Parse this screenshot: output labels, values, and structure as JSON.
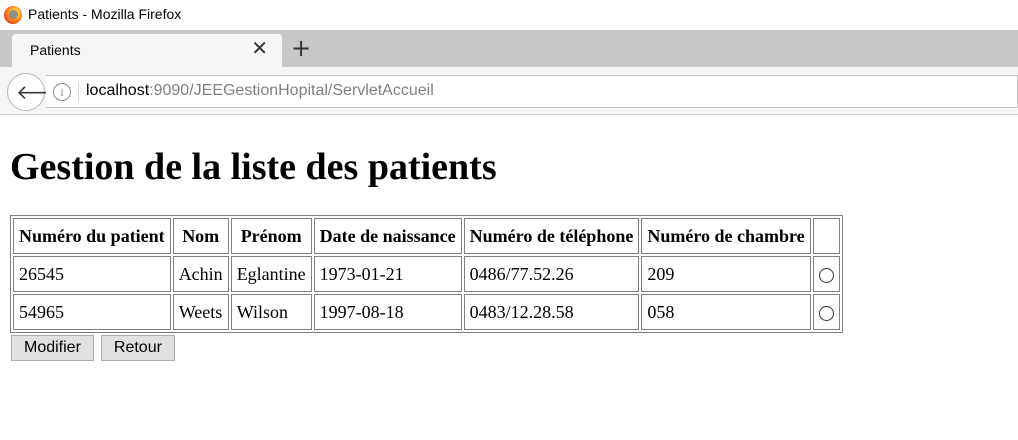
{
  "window": {
    "title": "Patients - Mozilla Firefox",
    "logo_icon": "firefox-logo-icon"
  },
  "tabs": [
    {
      "label": "Patients",
      "active": true
    }
  ],
  "toolbar": {
    "close_tab_glyph": "✕",
    "new_tab_glyph": "+",
    "back_glyph": "🡐",
    "info_glyph": "i",
    "url_host": "localhost",
    "url_rest": ":9090/JEEGestionHopital/ServletAccueil"
  },
  "page": {
    "heading": "Gestion de la liste des patients",
    "table": {
      "headers": [
        "Numéro du patient",
        "Nom",
        "Prénom",
        "Date de naissance",
        "Numéro de téléphone",
        "Numéro de chambre",
        ""
      ],
      "rows": [
        [
          "26545",
          "Achin",
          "Eglantine",
          "1973-01-21",
          "0486/77.52.26",
          "209"
        ],
        [
          "54965",
          "Weets",
          "Wilson",
          "1997-08-18",
          "0483/12.28.58",
          "058"
        ]
      ]
    },
    "buttons": {
      "modify": "Modifier",
      "back": "Retour"
    }
  },
  "colors": {
    "tabstrip": "#c8c8c8",
    "navbar": "#f5f6f7",
    "url_rest": "#808080"
  }
}
